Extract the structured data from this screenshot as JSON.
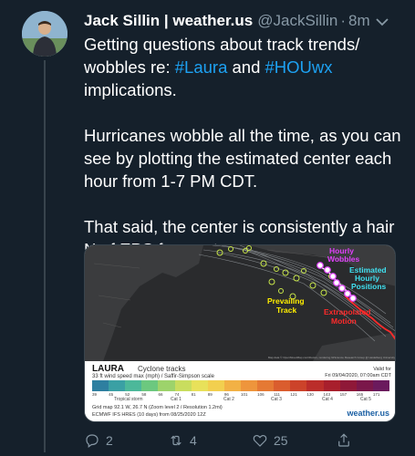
{
  "tweet": {
    "display_name": "Jack Sillin | weather.us",
    "handle": "@JackSillin",
    "separator": "·",
    "time": "8m",
    "paragraphs": [
      {
        "before": "Getting questions about track trends/ wobbles re: ",
        "tag1": "#Laura",
        "mid": " and ",
        "tag2": "#HOUwx",
        "after": " implications."
      },
      {
        "text": "Hurricanes wobble all the time, as you can see by plotting the estimated center each hour from 1-7 PM CDT."
      },
      {
        "text": "That said, the center is consistently a hair N of EPS forecasts."
      }
    ]
  },
  "media": {
    "annotations": {
      "hourly_wobbles": [
        "Hourly",
        "Wobbles"
      ],
      "estimated_positions": [
        "Estimated",
        "Hourly",
        "Positions"
      ],
      "prevailing_track": [
        "Prevailing",
        "Track"
      ],
      "extrapolated": [
        "Extrapolated",
        "Motion"
      ]
    },
    "map_credit": "Map data © OpenStreetMap contributors, rendering GIScience Research Group @ Heidelberg University",
    "legend": {
      "storm": "LAURA",
      "product": "Cyclone tracks",
      "subtitle": "33 ft wind speed max (mph) / Saffir-Simpson scale",
      "valid": [
        "Valid for",
        "Fri 09/04/2020, 07:00am CDT"
      ],
      "scale_values": [
        "39",
        "45",
        "52",
        "58",
        "66",
        "74",
        "81",
        "89",
        "96",
        "101",
        "106",
        "111",
        "121",
        "130",
        "143",
        "157",
        "165",
        "171"
      ],
      "categories": [
        "Tropical storm",
        "Cat 1",
        "Cat 2",
        "Cat 3",
        "Cat 4",
        "Cat 5"
      ],
      "footer1": "Grid map 92.1 W, 26.7 N (Zoom level 2 / Resolution 1.2mi)",
      "footer2": "ECMWF IFS HRES (10 days) from 08/25/2020 12Z",
      "brand": "weather.us"
    },
    "scale_colors": [
      "#2e7fa0",
      "#3aa0a4",
      "#4cb89a",
      "#6cc87f",
      "#9dd36b",
      "#c9dd5e",
      "#e8e15a",
      "#f2cf4f",
      "#f2b145",
      "#ee953c",
      "#e57934",
      "#da5d2e",
      "#cc432a",
      "#bb2d2a",
      "#a81f2c",
      "#8f1838",
      "#7a174a",
      "#6b1a5d"
    ]
  },
  "actions": {
    "reply_count": "2",
    "retweet_count": "4",
    "like_count": "25"
  },
  "colors": {
    "background": "#15202b",
    "link": "#1da1f2",
    "muted": "#8899a6",
    "wobble_label": "#e040fb",
    "positions_label": "#40e0f0",
    "prevailing_label": "#ffee00",
    "extrapolated_label": "#ff2a2a"
  }
}
